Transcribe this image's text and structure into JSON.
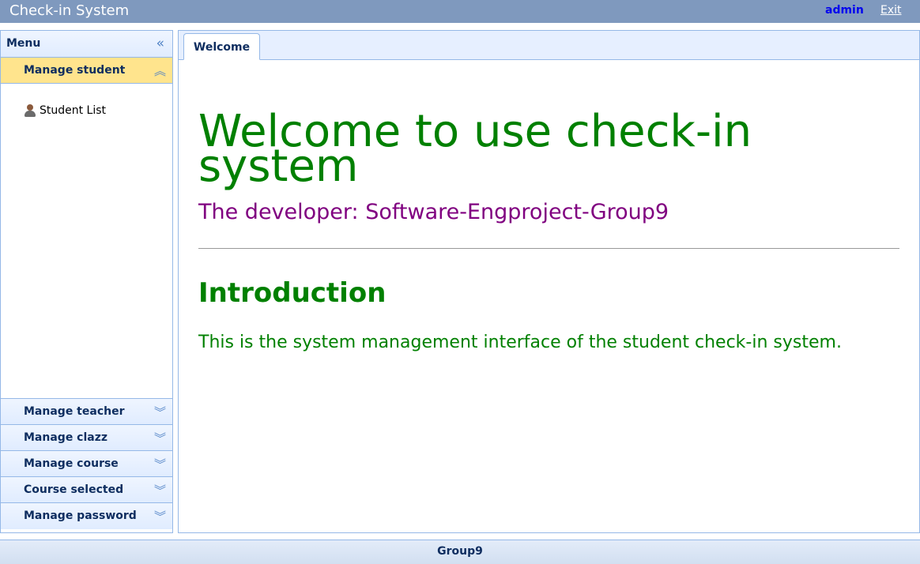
{
  "header": {
    "title": "Check-in System",
    "user": "admin",
    "exit_label": "Exit"
  },
  "menu": {
    "title": "Menu",
    "collapse_icon": "double-chevron-left-icon",
    "active_section": {
      "label": "Manage student",
      "icon": "double-chevron-up-icon",
      "items": [
        {
          "label": "Student List",
          "icon": "user-icon"
        }
      ]
    },
    "sections": [
      {
        "label": "Manage teacher",
        "icon": "double-chevron-down-icon"
      },
      {
        "label": "Manage clazz",
        "icon": "double-chevron-down-icon"
      },
      {
        "label": "Manage course",
        "icon": "double-chevron-down-icon"
      },
      {
        "label": "Course selected",
        "icon": "double-chevron-down-icon"
      },
      {
        "label": "Manage password",
        "icon": "double-chevron-down-icon"
      }
    ]
  },
  "tabs": [
    {
      "label": "Welcome",
      "active": true
    }
  ],
  "content": {
    "welcome": "Welcome to use check-in system",
    "developer": "The developer: Software-Engproject-Group9",
    "intro_heading": "Introduction",
    "intro_text": "This is the system management interface of the student check-in system."
  },
  "footer": {
    "text": "Group9"
  },
  "colors": {
    "topbar": "#7f99be",
    "active_section": "#ffe48d",
    "border": "#95b8e7",
    "welcome_green": "#008000",
    "developer_purple": "#800080"
  }
}
